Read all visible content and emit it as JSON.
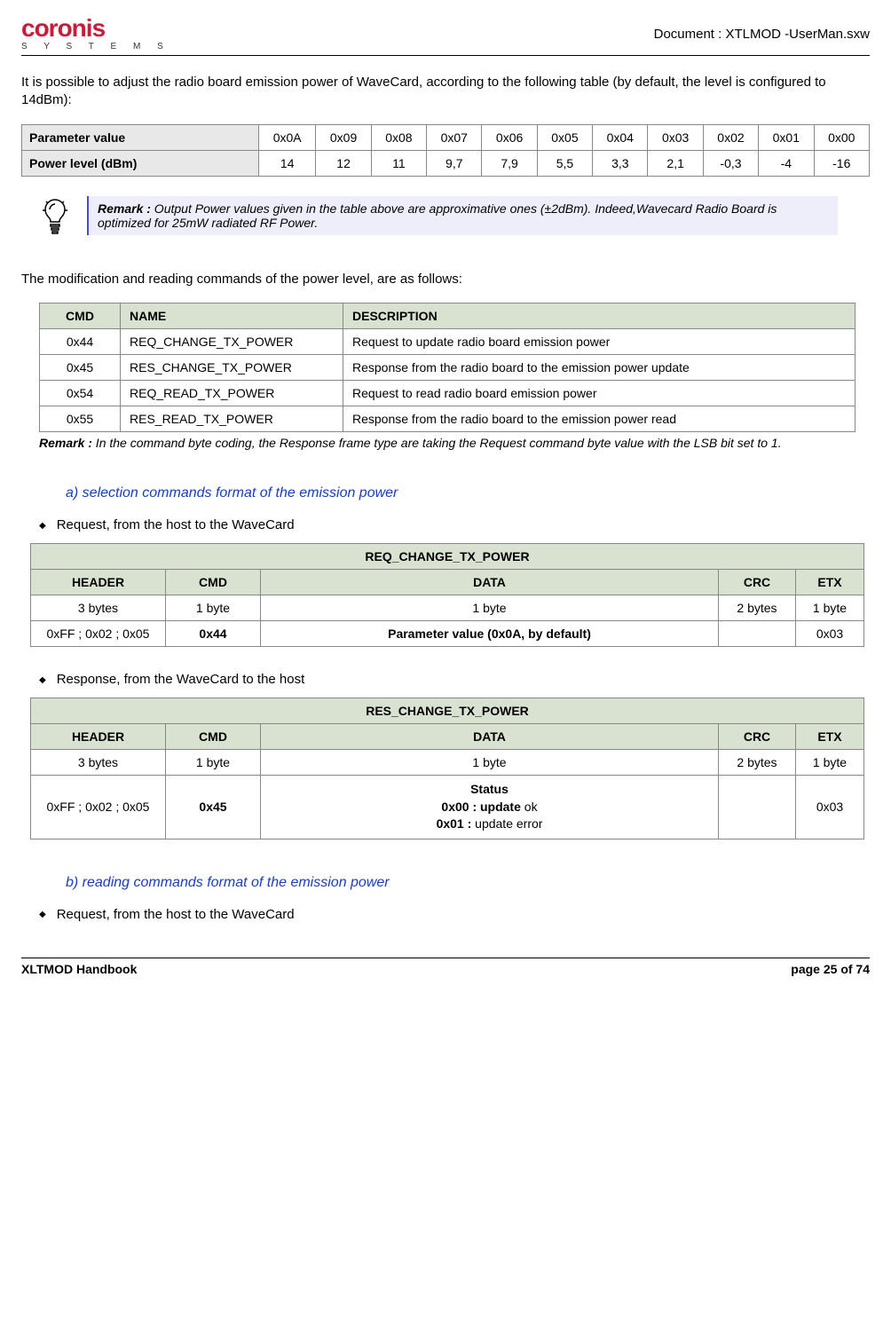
{
  "header": {
    "logo_top": "coronis",
    "logo_bottom": "S Y S T E M S",
    "doc": "Document : XTLMOD -UserMan.sxw"
  },
  "intro": "It is possible to adjust the radio board emission power of WaveCard, according to the following table (by default, the level is configured to 14dBm):",
  "power_table": {
    "row1_label": "Parameter value",
    "row1": [
      "0x0A",
      "0x09",
      "0x08",
      "0x07",
      "0x06",
      "0x05",
      "0x04",
      "0x03",
      "0x02",
      "0x01",
      "0x00"
    ],
    "row2_label": "Power level (dBm)",
    "row2": [
      "14",
      "12",
      "11",
      "9,7",
      "7,9",
      "5,5",
      "3,3",
      "2,1",
      "-0,3",
      "-4",
      "-16"
    ]
  },
  "remark1_label": "Remark :",
  "remark1_text": " Output Power values given in the table above are approximative ones (±2dBm). Indeed,Wavecard Radio Board is optimized for 25mW radiated RF Power.",
  "sentence2": "The modification and reading commands of the power level, are as follows:",
  "cmd_table": {
    "headers": [
      "CMD",
      "NAME",
      "DESCRIPTION"
    ],
    "rows": [
      [
        "0x44",
        "REQ_CHANGE_TX_POWER",
        "Request to update radio board emission power"
      ],
      [
        "0x45",
        "RES_CHANGE_TX_POWER",
        "Response from the radio board to the emission power update"
      ],
      [
        "0x54",
        "REQ_READ_TX_POWER",
        "Request to read radio board emission power"
      ],
      [
        "0x55",
        "RES_READ_TX_POWER",
        "Response from the radio board to the emission power read"
      ]
    ]
  },
  "remark2_label": "Remark :",
  "remark2_text": " In the command byte coding, the Response frame type are taking the Request command byte value with the LSB bit set to 1.",
  "section_a": "a) selection commands format of the emission power",
  "bullet_req": "Request, from the host to the WaveCard",
  "bullet_res": "Response, from the WaveCard to the host",
  "frame_req": {
    "title": "REQ_CHANGE_TX_POWER",
    "cols": [
      "HEADER",
      "CMD",
      "DATA",
      "CRC",
      "ETX"
    ],
    "sizes": [
      "3 bytes",
      "1 byte",
      "1 byte",
      "2 bytes",
      "1 byte"
    ],
    "vals": [
      "0xFF ; 0x02 ; 0x05",
      "0x44",
      "Parameter value (0x0A, by default)",
      "",
      "0x03"
    ]
  },
  "frame_res": {
    "title": "RES_CHANGE_TX_POWER",
    "cols": [
      "HEADER",
      "CMD",
      "DATA",
      "CRC",
      "ETX"
    ],
    "sizes": [
      "3 bytes",
      "1 byte",
      "1 byte",
      "2 bytes",
      "1 byte"
    ],
    "header_val": "0xFF ; 0x02 ; 0x05",
    "cmd_val": "0x45",
    "status_title": "Status",
    "status_ok": "0x00 : update",
    "status_ok_suffix": " ok",
    "status_err": "0x01 : ",
    "status_err_suffix": "update error",
    "etx_val": "0x03"
  },
  "section_b": "b) reading commands format of the emission power",
  "footer": {
    "left": "XLTMOD Handbook",
    "right": "page 25 of 74"
  }
}
